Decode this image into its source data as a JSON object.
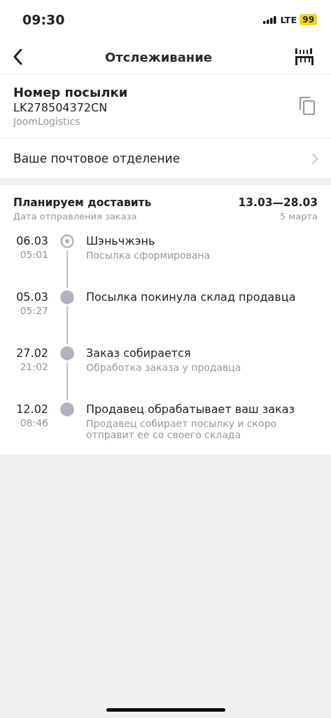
{
  "status_bar": {
    "time": "09:30",
    "network": "LTE",
    "battery": "99"
  },
  "header": {
    "title": "Отслеживание"
  },
  "parcel": {
    "label": "Номер посылки",
    "number": "LK278504372CN",
    "carrier": "JoomLogistics"
  },
  "post_office": {
    "label": "Ваше почтовое отделение"
  },
  "delivery": {
    "title": "Планируем доставить",
    "range": "13.03—28.03",
    "subtitle": "Дата отправления заказа",
    "ship_date": "5 марта"
  },
  "events": [
    {
      "date": "06.03",
      "time": "05:01",
      "title": "Шэньчжэнь",
      "description": "Посылка сформирована",
      "current": true
    },
    {
      "date": "05.03",
      "time": "05:27",
      "title": "Посылка покинула склад продавца",
      "current": false
    },
    {
      "date": "27.02",
      "time": "21:02",
      "title": "Заказ собирается",
      "description": "Обработка заказа у продавца",
      "current": false
    },
    {
      "date": "12.02",
      "time": "08:46",
      "title": "Продавец обрабатывает ваш заказ",
      "description": "Продавец собирает посылку и скоро отправит ее со своего склада",
      "current": false
    }
  ]
}
